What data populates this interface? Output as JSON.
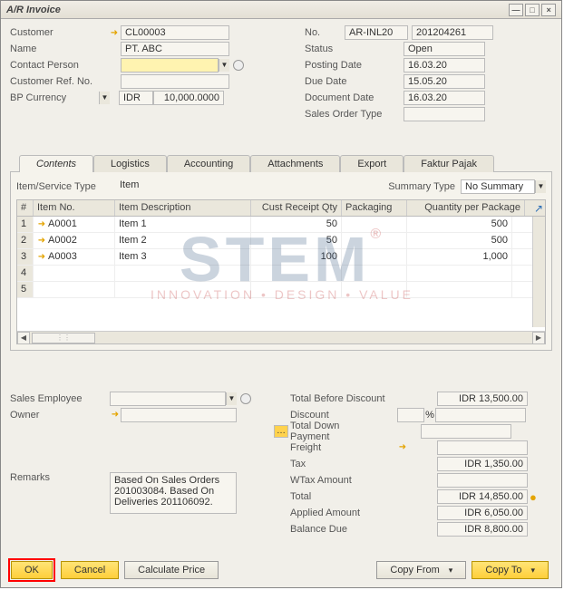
{
  "window": {
    "title": "A/R Invoice"
  },
  "header": {
    "left": {
      "customer_label": "Customer",
      "customer_value": "CL00003",
      "name_label": "Name",
      "name_value": "PT. ABC",
      "contact_label": "Contact Person",
      "contact_value": "",
      "custref_label": "Customer Ref. No.",
      "custref_value": "",
      "bpcur_label": "BP Currency",
      "bpcur_value": "IDR",
      "rate_value": "10,000.0000"
    },
    "right": {
      "no_label": "No.",
      "no_series": "AR-INL20",
      "no_value": "201204261",
      "status_label": "Status",
      "status_value": "Open",
      "postdate_label": "Posting Date",
      "postdate_value": "16.03.20",
      "duedate_label": "Due Date",
      "duedate_value": "15.05.20",
      "docdate_label": "Document Date",
      "docdate_value": "16.03.20",
      "sot_label": "Sales Order Type",
      "sot_value": ""
    }
  },
  "tabs": {
    "contents": "Contents",
    "logistics": "Logistics",
    "accounting": "Accounting",
    "attachments": "Attachments",
    "export": "Export",
    "faktur": "Faktur Pajak"
  },
  "contents": {
    "itemservice_label": "Item/Service Type",
    "itemservice_value": "Item",
    "summary_label": "Summary Type",
    "summary_value": "No Summary",
    "columns": {
      "hash": "#",
      "itemno": "Item No.",
      "desc": "Item Description",
      "custqty": "Cust Receipt Qty",
      "pack": "Packaging",
      "qpp": "Quantity per Package"
    },
    "rows": [
      {
        "n": "1",
        "itemno": "A0001",
        "desc": "Item 1",
        "custqty": "50",
        "pack": "",
        "qpp": "500"
      },
      {
        "n": "2",
        "itemno": "A0002",
        "desc": "Item 2",
        "custqty": "50",
        "pack": "",
        "qpp": "500"
      },
      {
        "n": "3",
        "itemno": "A0003",
        "desc": "Item 3",
        "custqty": "100",
        "pack": "",
        "qpp": "1,000"
      },
      {
        "n": "4",
        "itemno": "",
        "desc": "",
        "custqty": "",
        "pack": "",
        "qpp": ""
      },
      {
        "n": "5",
        "itemno": "",
        "desc": "",
        "custqty": "",
        "pack": "",
        "qpp": ""
      }
    ]
  },
  "bottom": {
    "salesemp_label": "Sales Employee",
    "salesemp_value": "",
    "owner_label": "Owner",
    "owner_value": "",
    "remarks_label": "Remarks",
    "remarks_value": "Based On Sales Orders 201003084. Based On Deliveries 201106092."
  },
  "totals": {
    "tbd_label": "Total Before Discount",
    "tbd_value": "IDR 13,500.00",
    "disc_label": "Discount",
    "disc_pct": "",
    "disc_pct_unit": "%",
    "tdp_label": "Total Down Payment",
    "tdp_value": "",
    "freight_label": "Freight",
    "freight_value": "",
    "tax_label": "Tax",
    "tax_value": "IDR 1,350.00",
    "wtax_label": "WTax Amount",
    "wtax_value": "",
    "total_label": "Total",
    "total_value": "IDR 14,850.00",
    "applied_label": "Applied Amount",
    "applied_value": "IDR 6,050.00",
    "bal_label": "Balance Due",
    "bal_value": "IDR 8,800.00"
  },
  "footer": {
    "ok": "OK",
    "cancel": "Cancel",
    "calc": "Calculate Price",
    "copyfrom": "Copy From",
    "copyto": "Copy To"
  },
  "watermark": {
    "brand": "STEM",
    "tagline": "INNOVATION • DESIGN • VALUE"
  }
}
